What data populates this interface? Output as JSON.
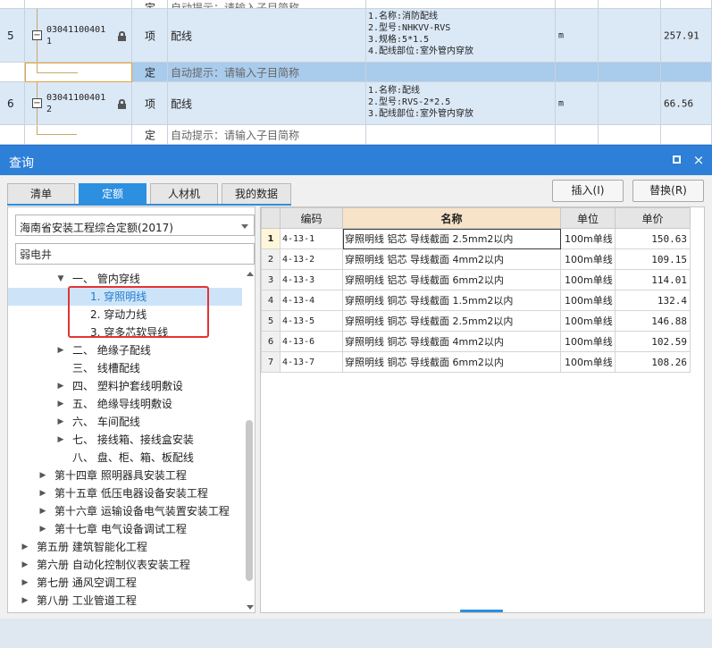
{
  "grid": {
    "top_partial": {
      "type": "定",
      "hint": "自动提示：请输入子目简称"
    },
    "rows": [
      {
        "num": "5",
        "code": "03041100401\n1",
        "type": "项",
        "name": "配线",
        "features": [
          "1.名称:消防配线",
          "2.型号:NHKVV-RVS",
          "3.规格:5*1.5",
          "4.配线部位:室外管内穿放"
        ],
        "unit": "m",
        "qty": "257.91"
      },
      {
        "num": "6",
        "code": "03041100401\n2",
        "type": "项",
        "name": "配线",
        "features": [
          "1.名称:配线",
          "2.型号:RVS-2*2.5",
          "3.配线部位:室外管内穿放"
        ],
        "unit": "m",
        "qty": "66.56"
      }
    ],
    "sub_row": {
      "type": "定",
      "hint": "自动提示：请输入子目简称"
    }
  },
  "dialog": {
    "title": "查询",
    "window_controls": {
      "restore_icon": "restore-icon",
      "close_icon": "×"
    },
    "tabs": [
      "清单",
      "定额",
      "人材机",
      "我的数据"
    ],
    "active_tab": "定额",
    "insert_button": "插入(I)",
    "replace_button": "替换(R)",
    "library_select": "海南省安装工程综合定额(2017)",
    "search_value": "弱电井",
    "tree": [
      {
        "label": "一、 管内穿线",
        "indent": 2,
        "arrow": "▼"
      },
      {
        "label": "1. 穿照明线",
        "indent": 4,
        "arrow": "",
        "selected": true
      },
      {
        "label": "2. 穿动力线",
        "indent": 4,
        "arrow": ""
      },
      {
        "label": "3. 穿多芯软导线",
        "indent": 4,
        "arrow": ""
      },
      {
        "label": "二、 绝缘子配线",
        "indent": 2,
        "arrow": "▶"
      },
      {
        "label": "三、 线槽配线",
        "indent": 2,
        "arrow": ""
      },
      {
        "label": "四、 塑料护套线明敷设",
        "indent": 2,
        "arrow": "▶"
      },
      {
        "label": "五、 绝缘导线明敷设",
        "indent": 2,
        "arrow": "▶"
      },
      {
        "label": "六、 车间配线",
        "indent": 2,
        "arrow": "▶"
      },
      {
        "label": "七、 接线箱、接线盒安装",
        "indent": 2,
        "arrow": "▶"
      },
      {
        "label": "八、 盘、柜、箱、板配线",
        "indent": 2,
        "arrow": ""
      },
      {
        "label": "第十四章 照明器具安装工程",
        "indent": 1,
        "arrow": "▶"
      },
      {
        "label": "第十五章 低压电器设备安装工程",
        "indent": 1,
        "arrow": "▶"
      },
      {
        "label": "第十六章 运输设备电气装置安装工程",
        "indent": 1,
        "arrow": "▶"
      },
      {
        "label": "第十七章 电气设备调试工程",
        "indent": 1,
        "arrow": "▶"
      },
      {
        "label": "第五册 建筑智能化工程",
        "indent": 0,
        "arrow": "▶"
      },
      {
        "label": "第六册 自动化控制仪表安装工程",
        "indent": 0,
        "arrow": "▶"
      },
      {
        "label": "第七册 通风空调工程",
        "indent": 0,
        "arrow": "▶"
      },
      {
        "label": "第八册 工业管道工程",
        "indent": 0,
        "arrow": "▶"
      }
    ],
    "table": {
      "headers": [
        "编码",
        "名称",
        "单位",
        "单价"
      ],
      "rows": [
        {
          "n": "1",
          "code": "4-13-1",
          "name": "穿照明线 铝芯 导线截面 2.5mm2以内",
          "unit": "100m单线",
          "price": "150.63"
        },
        {
          "n": "2",
          "code": "4-13-2",
          "name": "穿照明线 铝芯 导线截面 4mm2以内",
          "unit": "100m单线",
          "price": "109.15"
        },
        {
          "n": "3",
          "code": "4-13-3",
          "name": "穿照明线 铝芯 导线截面 6mm2以内",
          "unit": "100m单线",
          "price": "114.01"
        },
        {
          "n": "4",
          "code": "4-13-4",
          "name": "穿照明线 铜芯 导线截面 1.5mm2以内",
          "unit": "100m单线",
          "price": "132.4"
        },
        {
          "n": "5",
          "code": "4-13-5",
          "name": "穿照明线 铜芯 导线截面 2.5mm2以内",
          "unit": "100m单线",
          "price": "146.88"
        },
        {
          "n": "6",
          "code": "4-13-6",
          "name": "穿照明线 铜芯 导线截面 4mm2以内",
          "unit": "100m单线",
          "price": "102.59"
        },
        {
          "n": "7",
          "code": "4-13-7",
          "name": "穿照明线 铜芯 导线截面 6mm2以内",
          "unit": "100m单线",
          "price": "108.26"
        }
      ]
    }
  }
}
